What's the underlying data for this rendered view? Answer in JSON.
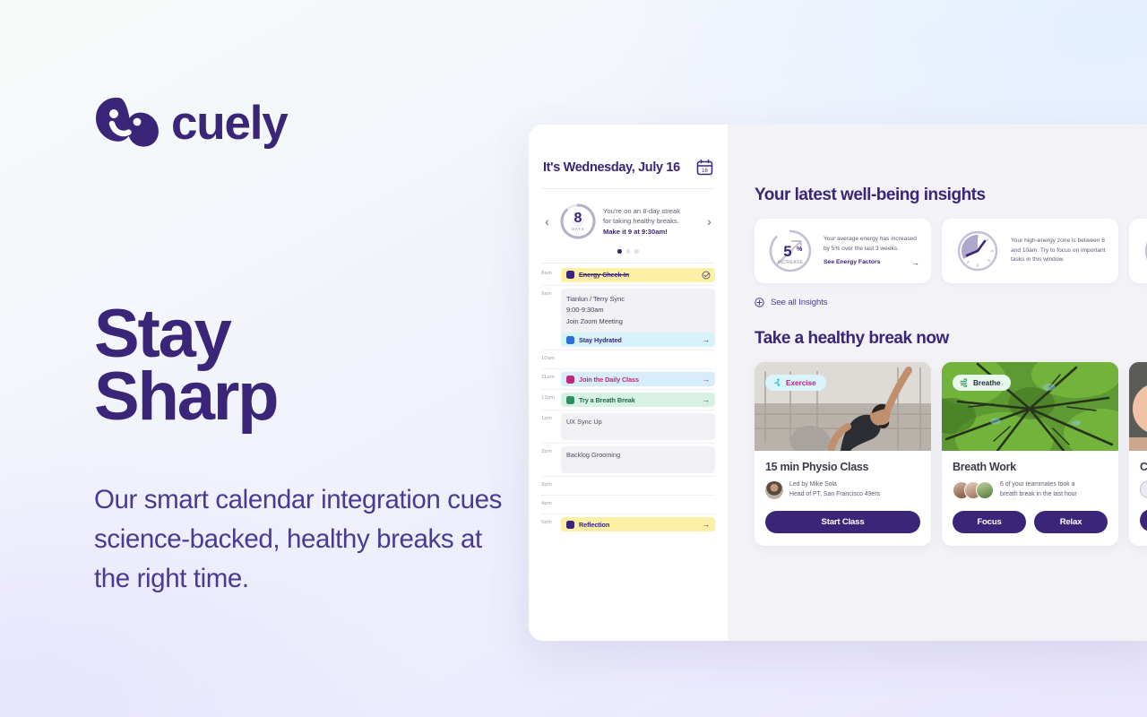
{
  "brand": {
    "name": "cuely",
    "color": "#3b2579"
  },
  "hero": {
    "headline_line1": "Stay",
    "headline_line2": "Sharp",
    "subcopy": "Our smart calendar integration cues science-backed, healthy breaks at the right time."
  },
  "calendar": {
    "title": "It's Wednesday, July 16",
    "calendar_icon_day": "16",
    "prev_label": "‹",
    "next_label": "›",
    "streak": {
      "count": "8",
      "unit": "DAYS",
      "text_line1": "You're on an 8-day streak",
      "text_line2": "for taking healthy breaks.",
      "text_bold": "Make it 9 at 9:30am!"
    },
    "pager": {
      "total": 3,
      "active": 1
    },
    "slots": [
      {
        "time": "8am",
        "kind": "event",
        "style": "yellow",
        "label": "Energy Check-In",
        "done": true,
        "after": "check"
      },
      {
        "time": "9am",
        "kind": "meeting",
        "lines": [
          "Tianlun / Terry Sync",
          "9:00-9:30am",
          "Join Zoom Meeting"
        ],
        "sub": {
          "style": "cyan",
          "label": "Stay Hydrated",
          "after": "→"
        }
      },
      {
        "time": "10am",
        "kind": "empty"
      },
      {
        "time": "11am",
        "kind": "event",
        "style": "pink",
        "label": "Join the Daily Class",
        "after": "→"
      },
      {
        "time": "12pm",
        "kind": "event",
        "style": "green",
        "label": "Try a Breath Break",
        "after": "→"
      },
      {
        "time": "1pm",
        "kind": "plain",
        "label": "UX Sync Up"
      },
      {
        "time": "2pm",
        "kind": "plain",
        "label": "Backlog Grooming"
      },
      {
        "time": "3pm",
        "kind": "empty"
      },
      {
        "time": "4pm",
        "kind": "empty"
      },
      {
        "time": "5pm",
        "kind": "event",
        "style": "yellow",
        "label": "Reflection",
        "after": "→"
      }
    ]
  },
  "insights": {
    "section_title": "Your latest well-being insights",
    "see_all_label": "See all Insights",
    "cards": [
      {
        "gfx": "gauge-increase",
        "value": "5",
        "value_suffix": "%",
        "value_caption": "INCREASE",
        "text": "Your average energy has increased by 5% over the last 3 weeks.",
        "link": "See Energy Factors",
        "link_arrow": "→"
      },
      {
        "gfx": "clock-zone",
        "text": "Your high-energy zone is between 8 and 10am. Try to focus on important tasks in this window."
      },
      {
        "gfx": "dial-meter",
        "text": ""
      }
    ]
  },
  "breaks": {
    "section_title": "Take a healthy break now",
    "cards": [
      {
        "image": "gym-stretch-photo",
        "pill": "Exercise",
        "pill_icon": "runner-icon",
        "title": "15 min Physio Class",
        "sub_line1": "Led by Mike Sola",
        "sub_line2": "Head of PT, San Francisco 49ers",
        "avatar": "mike-sola-avatar",
        "buttons": [
          "Start Class"
        ]
      },
      {
        "image": "forest-canopy-photo",
        "pill": "Breathe",
        "pill_icon": "wind-icon",
        "title": "Breath Work",
        "sub_line1": "6 of your teammates took a",
        "sub_line2": "breath break in the last hour",
        "avatar": "teammates-avatar-stack",
        "buttons": [
          "Focus",
          "Relax"
        ]
      },
      {
        "image": "person-photo",
        "pill": "",
        "title": "C",
        "sub_line1": "",
        "sub_line2": "",
        "buttons": [
          ""
        ]
      }
    ]
  }
}
